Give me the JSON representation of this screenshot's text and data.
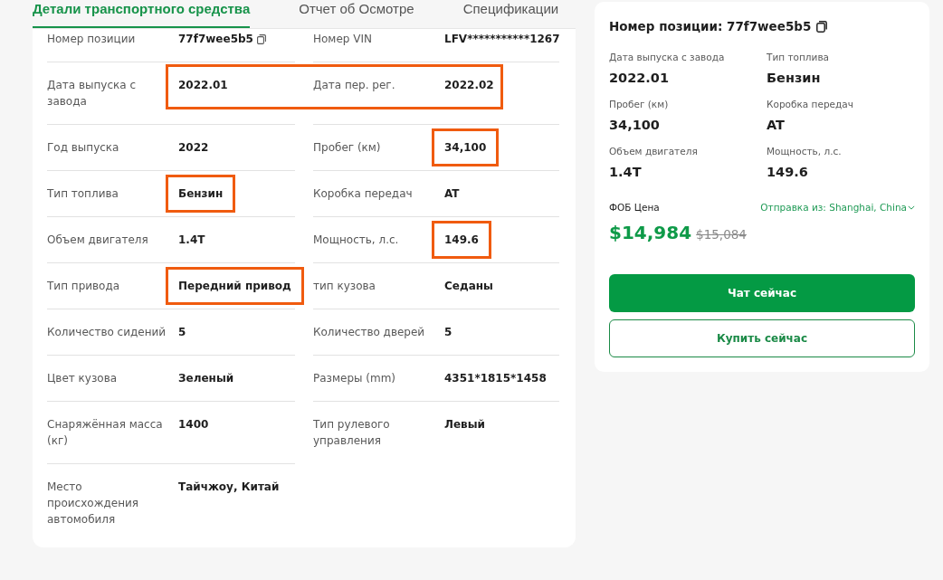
{
  "tabs": [
    {
      "label": "Детали транспортного средства",
      "selected": true
    },
    {
      "label": "Отчет об Осмотре",
      "selected": false
    },
    {
      "label": "Спецификации",
      "selected": false
    }
  ],
  "specs": {
    "rows": [
      {
        "highlighted": false,
        "cells": [
          {
            "label": "Номер позиции",
            "value": "77f7wee5b5",
            "copyable": true,
            "highlighted": false
          },
          {
            "label": "Номер VIN",
            "value": "LFV***********1267",
            "highlighted": false
          }
        ]
      },
      {
        "highlighted": true,
        "cells": [
          {
            "label": "Дата выпуска с завода",
            "value": "2022.01",
            "highlighted": false
          },
          {
            "label": "Дата пер. рег.",
            "value": "2022.02",
            "highlighted": false
          }
        ]
      },
      {
        "highlighted": false,
        "cells": [
          {
            "label": "Год выпуска",
            "value": "2022",
            "highlighted": false
          },
          {
            "label": "Пробег (км)",
            "value": "34,100",
            "highlighted": true
          }
        ]
      },
      {
        "highlighted": false,
        "cells": [
          {
            "label": "Тип топлива",
            "value": "Бензин",
            "highlighted": true
          },
          {
            "label": "Коробка передач",
            "value": "AT",
            "highlighted": false
          }
        ]
      },
      {
        "highlighted": false,
        "cells": [
          {
            "label": "Объем двигателя",
            "value": "1.4T",
            "highlighted": false
          },
          {
            "label": "Мощность, л.с.",
            "value": "149.6",
            "highlighted": true
          }
        ]
      },
      {
        "highlighted": false,
        "cells": [
          {
            "label": "Тип привода",
            "value": "Передний привод",
            "highlighted": true
          },
          {
            "label": "тип кузова",
            "value": "Седаны",
            "highlighted": false
          }
        ]
      },
      {
        "highlighted": false,
        "cells": [
          {
            "label": "Количество сидений",
            "value": "5",
            "highlighted": false
          },
          {
            "label": "Количество дверей",
            "value": "5",
            "highlighted": false
          }
        ]
      },
      {
        "highlighted": false,
        "cells": [
          {
            "label": "Цвет кузова",
            "value": "Зеленый",
            "highlighted": false
          },
          {
            "label": "Размеры (mm)",
            "value": "4351*1815*1458",
            "highlighted": false
          }
        ]
      },
      {
        "highlighted": false,
        "cells": [
          {
            "label": "Снаряжённая масса (кг)",
            "value": "1400",
            "highlighted": false
          },
          {
            "label": "Тип рулевого управления",
            "value": "Левый",
            "highlighted": false
          }
        ]
      },
      {
        "highlighted": false,
        "cells": [
          {
            "label": "Место происхождения автомобиля",
            "value": "Тайчжоу, Китай",
            "highlighted": false
          }
        ]
      }
    ]
  },
  "summary": {
    "title": "Номер позиции: 77f7wee5b5",
    "copyable": true,
    "facts": [
      {
        "label": "Дата выпуска с завода",
        "value": "2022.01"
      },
      {
        "label": "Тип топлива",
        "value": "Бензин"
      },
      {
        "label": "Пробег (км)",
        "value": "34,100"
      },
      {
        "label": "Коробка передач",
        "value": "AT"
      },
      {
        "label": "Объем двигателя",
        "value": "1.4T"
      },
      {
        "label": "Мощность, л.с.",
        "value": "149.6"
      }
    ],
    "price_label": "ФОБ Цена",
    "ship_from": "Отправка из: Shanghai, China",
    "price": "$14,984",
    "old_price": "$15,084",
    "buttons": [
      {
        "label": "Чат сейчас",
        "kind": "primary"
      },
      {
        "label": "Купить сейчас",
        "kind": "outline"
      }
    ]
  }
}
